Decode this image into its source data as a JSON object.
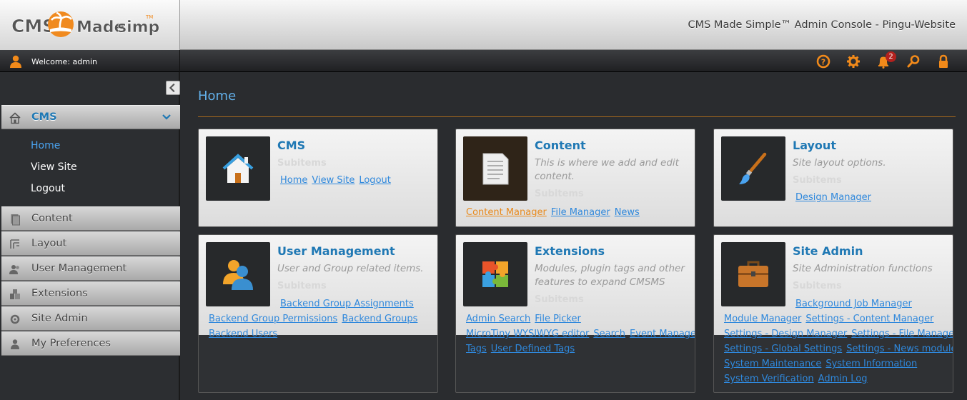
{
  "header": {
    "logo_text": "CMS Made Simple",
    "console_title": "CMS Made Simple™ Admin Console - Pingu-Website"
  },
  "userbar": {
    "welcome": "Welcome: admin",
    "notification_count": "2",
    "tools": [
      "help-icon",
      "settings-icon",
      "notifications-icon",
      "search-icon",
      "logout-lock-icon"
    ]
  },
  "sidebar": {
    "cms": {
      "label": "CMS",
      "children": [
        "Home",
        "View Site",
        "Logout"
      ]
    },
    "sections": [
      "Content",
      "Layout",
      "User Management",
      "Extensions",
      "Site Admin",
      "My Preferences"
    ]
  },
  "main": {
    "title": "Home"
  },
  "cards": [
    {
      "title": "CMS",
      "description": "",
      "subitems": "Subitems",
      "links": [
        "Home",
        "View Site",
        "Logout"
      ]
    },
    {
      "title": "Content",
      "description": "This is where we add and edit content.",
      "subitems": "Subitems",
      "links": [
        "Content Manager",
        "File Manager",
        "News"
      ]
    },
    {
      "title": "Layout",
      "description": "Site layout options.",
      "subitems": "Subitems",
      "links": [
        "Design Manager"
      ]
    },
    {
      "title": "User Management",
      "description": "User and Group related items.",
      "subitems": "Subitems",
      "links": [
        "Backend Group Assignments",
        "Backend Group Permissions",
        "Backend Groups",
        "Backend Users"
      ]
    },
    {
      "title": "Extensions",
      "description": "Modules, plugin tags and other features to expand CMSMS",
      "subitems": "Subitems",
      "links": [
        "Admin Search",
        "File Picker",
        "MicroTiny WYSIWYG editor",
        "Search",
        "Event Manager",
        "Tags",
        "User Defined Tags"
      ]
    },
    {
      "title": "Site Admin",
      "description": "Site Administration functions",
      "subitems": "Subitems",
      "links": [
        "Background Job Manager",
        "Module Manager",
        "Settings - Content Manager",
        "Settings - Design Manager",
        "Settings - File Manager",
        "Settings - Global Settings",
        "Settings - News module",
        "System Maintenance",
        "System Information",
        "System Verification",
        "Admin Log"
      ]
    }
  ],
  "colors": {
    "accent": "#1f78b4",
    "link": "#2f88dc",
    "active_link": "#e98a1c",
    "orange": "#f28a1a"
  }
}
